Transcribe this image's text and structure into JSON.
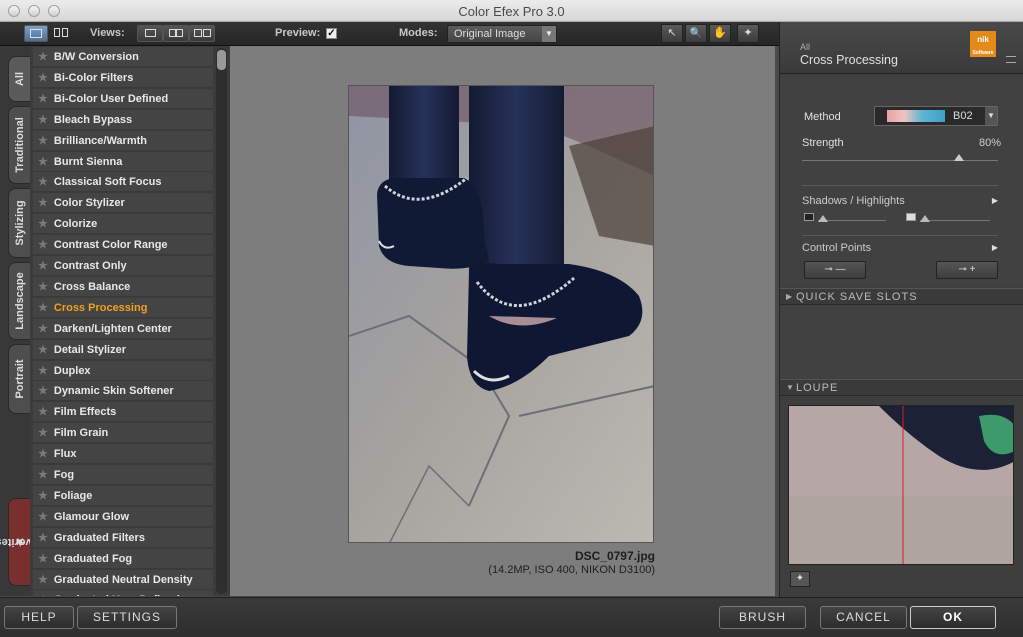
{
  "window": {
    "title": "Color Efex Pro 3.0"
  },
  "toolbar": {
    "views_label": "Views:",
    "preview_label": "Preview:",
    "preview_check": "✓",
    "modes_label": "Modes:",
    "mode_value": "Original Image",
    "mode_arrow": "▼",
    "tools": [
      "↖",
      "🔍",
      "✋",
      "✦"
    ]
  },
  "tabs": [
    {
      "label": "All"
    },
    {
      "label": "Traditional"
    },
    {
      "label": "Stylizing"
    },
    {
      "label": "Landscape"
    },
    {
      "label": "Portrait"
    },
    {
      "label": "Favorites"
    }
  ],
  "filters": {
    "star": "★",
    "active_index": 12,
    "items": [
      "B/W Conversion",
      "Bi-Color Filters",
      "Bi-Color User Defined",
      "Bleach Bypass",
      "Brilliance/Warmth",
      "Burnt Sienna",
      "Classical Soft Focus",
      "Color Stylizer",
      "Colorize",
      "Contrast Color Range",
      "Contrast Only",
      "Cross Balance",
      "Cross Processing",
      "Darken/Lighten Center",
      "Detail Stylizer",
      "Duplex",
      "Dynamic Skin Softener",
      "Film Effects",
      "Film Grain",
      "Flux",
      "Fog",
      "Foliage",
      "Glamour Glow",
      "Graduated Filters",
      "Graduated Fog",
      "Graduated Neutral Density",
      "Graduated User Defined"
    ]
  },
  "preview": {
    "filename": "DSC_0797.jpg",
    "details": "(14.2MP, ISO 400, NIKON D3100)"
  },
  "panel": {
    "category": "All",
    "filter_name": "Cross Processing",
    "logo_text": "nik",
    "logo_sub": "Software",
    "method_label": "Method",
    "method_value": "B02",
    "method_arrow": "▼",
    "strength_label": "Strength",
    "strength_value": "80%",
    "strength_fraction": 0.8,
    "shadows_label": "Shadows / Highlights",
    "control_points_label": "Control Points",
    "section_arrow": "▶",
    "cp_add": "⊸ —",
    "cp_add2": "⊸ +",
    "quick_save": "QUICK SAVE SLOTS",
    "loupe": "LOUPE",
    "collapsed_arrow": "▶",
    "expanded_arrow": "▼",
    "loupe_pin": "✦"
  },
  "bottom": {
    "help": "HELP",
    "settings": "SETTINGS",
    "brush": "BRUSH",
    "cancel": "CANCEL",
    "ok": "OK"
  }
}
